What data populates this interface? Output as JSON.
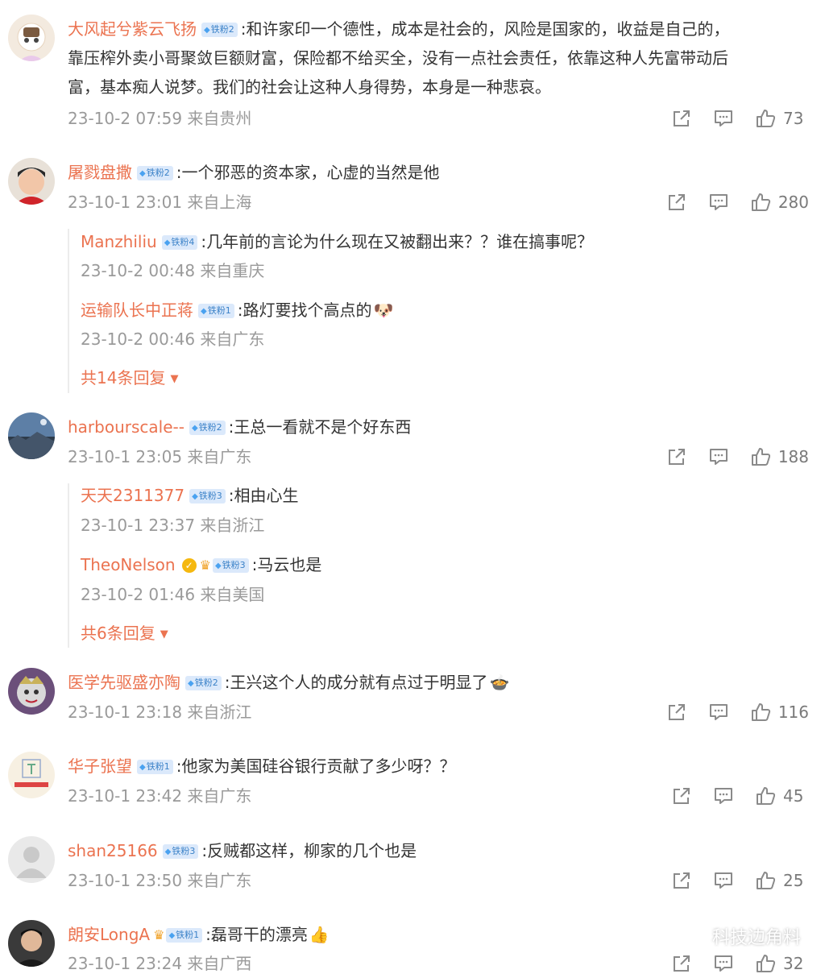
{
  "badge_prefix": "◆",
  "comments": [
    {
      "user": "大风起兮紫云飞扬",
      "badge": "铁粉2",
      "text_lines": [
        ":和许家印一个德性，成本是社会的，风险是国家的，收益是自己的，",
        "靠压榨外卖小哥聚敛巨额财富，保险都不给买全，没有一点社会责任，依靠这种人先富带动后",
        "富，基本痴人说梦。我们的社会让这种人身得势，本身是一种悲哀。"
      ],
      "meta": "23-10-2 07:59 来自贵州",
      "likes": "73"
    },
    {
      "user": "屠戮盘撒",
      "badge": "铁粉2",
      "text": ":一个邪恶的资本家，心虚的当然是他",
      "meta": "23-10-1 23:01 来自上海",
      "likes": "280",
      "replies": [
        {
          "user": "Manzhiliu",
          "badge": "铁粉4",
          "text": ":几年前的言论为什么现在又被翻出来？？谁在搞事呢？",
          "meta": "23-10-2 00:48 来自重庆"
        },
        {
          "user": "运输队长中正蒋",
          "badge": "铁粉1",
          "text": ":路灯要找个高点的",
          "emoji": "🐶",
          "meta": "23-10-2 00:46 来自广东"
        }
      ],
      "more": "共14条回复"
    },
    {
      "user": "harbourscale--",
      "badge": "铁粉2",
      "text": ":王总一看就不是个好东西",
      "meta": "23-10-1 23:05 来自广东",
      "likes": "188",
      "replies": [
        {
          "user": "天天2311377",
          "badge": "铁粉3",
          "text": ":相由心生",
          "meta": "23-10-1 23:37 来自浙江"
        },
        {
          "user": "TheoNelson",
          "badge": "铁粉3",
          "text": ":马云也是",
          "meta": "23-10-2 01:46 来自美国"
        }
      ],
      "more": "共6条回复"
    },
    {
      "user": "医学先驱盛亦陶",
      "badge": "铁粉2",
      "text": ":王兴这个人的成分就有点过于明显了",
      "emoji": "🍲",
      "meta": "23-10-1 23:18 来自浙江",
      "likes": "116"
    },
    {
      "user": "华子张望",
      "badge": "铁粉1",
      "text": ":他家为美国硅谷银行贡献了多少呀？？",
      "meta": "23-10-1 23:42 来自广东",
      "likes": "45"
    },
    {
      "user": "shan25166",
      "badge": "铁粉3",
      "text": ":反贼都这样，柳家的几个也是",
      "meta": "23-10-1 23:50 来自广东",
      "likes": "25"
    },
    {
      "user": "朗安LongA",
      "badge": "铁粉1",
      "text": ":磊哥干的漂亮",
      "emoji": "👍",
      "meta": "23-10-1 23:24 来自广西",
      "likes": "32"
    }
  ],
  "watermark": "科技边角料",
  "colors": {
    "username": "#eb7350",
    "meta": "#9a9a9a",
    "badge_bg": "#dbe9fb"
  },
  "icons": [
    "share-icon",
    "comment-icon",
    "like-icon",
    "caret-down-icon",
    "verified-icon",
    "crown-icon"
  ]
}
